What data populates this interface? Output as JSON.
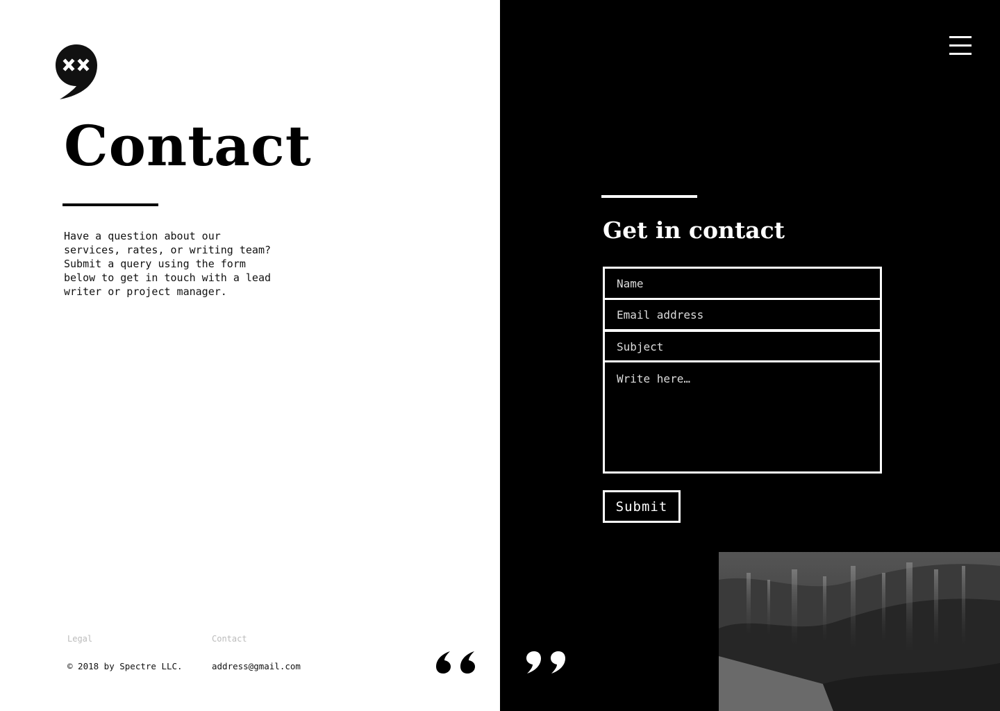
{
  "hero": {
    "title": "Contact",
    "intro": "Have a question about our\nservices, rates, or writing team?\nSubmit a query using the form\nbelow to get in touch with a lead\nwriter or project manager."
  },
  "footer": {
    "legal_label": "Legal",
    "contact_label": "Contact",
    "copyright": "© 2018 by Spectre LLC.",
    "email": "address@gmail.com"
  },
  "form": {
    "title": "Get in contact",
    "name_placeholder": "Name",
    "email_placeholder": "Email address",
    "subject_placeholder": "Subject",
    "message_placeholder": "Write here…",
    "submit_label": "Submit"
  },
  "icons": {
    "logo": "speech-bubble-logo-icon",
    "menu": "hamburger-menu-icon",
    "open_quote": "open-quote-icon",
    "close_quote": "close-quote-icon"
  },
  "colors": {
    "left_background": "#ffffff",
    "right_background": "#000000",
    "text_dark": "#000000",
    "text_light": "#ffffff",
    "footer_label": "#bbbbbb"
  }
}
